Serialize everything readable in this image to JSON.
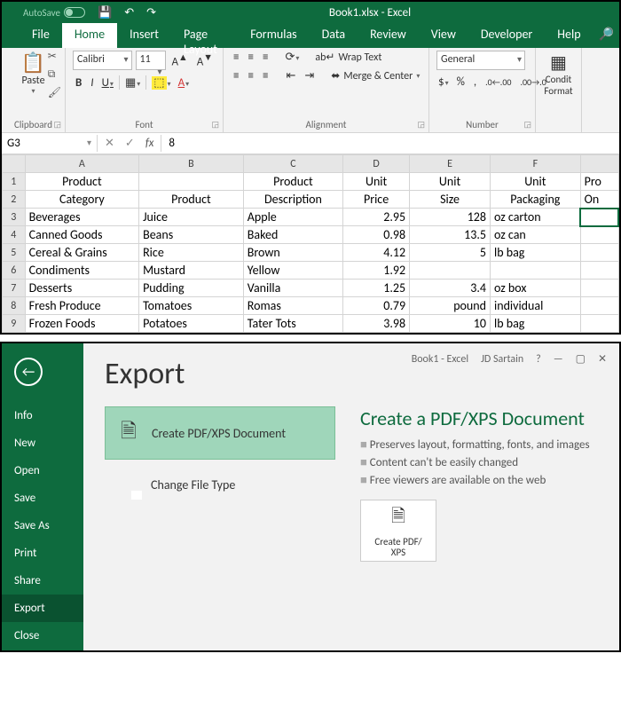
{
  "titlebar": {
    "autosave": "AutoSave",
    "doc": "Book1.xlsx - Excel"
  },
  "tabs": [
    "File",
    "Home",
    "Insert",
    "Page Layout",
    "Formulas",
    "Data",
    "Review",
    "View",
    "Developer",
    "Help"
  ],
  "active_tab": "Home",
  "ribbon": {
    "clipboard": {
      "label": "Clipboard",
      "paste": "Paste"
    },
    "font": {
      "label": "Font",
      "name": "Calibri",
      "size": "11"
    },
    "alignment": {
      "label": "Alignment",
      "wrap": "Wrap Text",
      "merge": "Merge & Center"
    },
    "number": {
      "label": "Number",
      "format": "General"
    },
    "cond": {
      "line1": "Condit",
      "line2": "Format"
    }
  },
  "namebox": "G3",
  "formula": "8",
  "columns": [
    "A",
    "B",
    "C",
    "D",
    "E",
    "F",
    ""
  ],
  "headers1": [
    "Product",
    "",
    "Product",
    "Unit",
    "Unit",
    "Unit",
    "Pro"
  ],
  "headers2": [
    "Category",
    "Product",
    "Description",
    "Price",
    "Size",
    "Packaging",
    "On"
  ],
  "rows": [
    {
      "n": "3",
      "a": "Beverages",
      "b": "Juice",
      "c": "Apple",
      "d": "2.95",
      "e": "128",
      "f": "oz carton",
      "g": ""
    },
    {
      "n": "4",
      "a": "Canned Goods",
      "b": "Beans",
      "c": "Baked",
      "d": "0.98",
      "e": "13.5",
      "f": "oz can",
      "g": ""
    },
    {
      "n": "5",
      "a": "Cereal & Grains",
      "b": "Rice",
      "c": "Brown",
      "d": "4.12",
      "e": "5",
      "f": "lb bag",
      "g": ""
    },
    {
      "n": "6",
      "a": "Condiments",
      "b": "Mustard",
      "c": "Yellow",
      "d": "1.92",
      "e": "",
      "f": "",
      "g": ""
    },
    {
      "n": "7",
      "a": "Desserts",
      "b": "Pudding",
      "c": "Vanilla",
      "d": "1.25",
      "e": "3.4",
      "f": "oz box",
      "g": ""
    },
    {
      "n": "8",
      "a": "Fresh Produce",
      "b": "Tomatoes",
      "c": "Romas",
      "d": "0.79",
      "e": "pound",
      "f": "individual",
      "g": ""
    },
    {
      "n": "9",
      "a": "Frozen Foods",
      "b": "Potatoes",
      "c": "Tater Tots",
      "d": "3.98",
      "e": "10",
      "f": "lb bag",
      "g": ""
    }
  ],
  "backstage": {
    "title_app": "Book1  -  Excel",
    "user": "JD Sartain",
    "menu": [
      "Info",
      "New",
      "Open",
      "Save",
      "Save As",
      "Print",
      "Share",
      "Export",
      "Close"
    ],
    "active": "Export",
    "heading": "Export",
    "opts": [
      {
        "label": "Create PDF/XPS Document"
      },
      {
        "label": "Change File Type"
      }
    ],
    "detail": {
      "title": "Create a PDF/XPS Document",
      "bullets": [
        "Preserves layout, formatting, fonts, and images",
        "Content can't be easily changed",
        "Free viewers are available on the web"
      ],
      "button": "Create PDF/\nXPS"
    }
  }
}
